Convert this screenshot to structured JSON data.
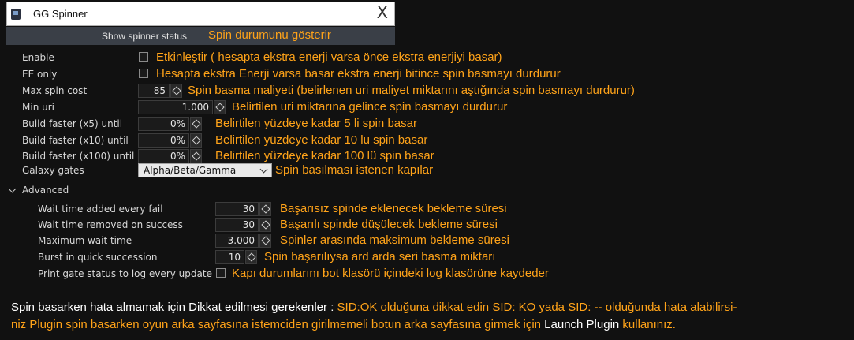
{
  "window": {
    "title": "GG Spinner",
    "close_glyph": "X"
  },
  "status": {
    "label": "Show spinner status",
    "note": "Spin durumunu gösterir"
  },
  "rows": {
    "enable": {
      "label": "Enable",
      "note": "Etkinleştir  ( hesapta ekstra enerji varsa önce  ekstra enerjiyi  basar)"
    },
    "ee_only": {
      "label": "EE only",
      "note": "Hesapta ekstra Enerji varsa basar ekstra enerji bitince spin basmayı  durdurur"
    },
    "max_spin_cost": {
      "label": "Max spin cost",
      "value": "85",
      "note": "Spin basma maliyeti (belirlenen uri maliyet miktarını aştığında spin basmayı durdurur)"
    },
    "min_uri": {
      "label": "Min uri",
      "value": "1.000",
      "note": "Belirtilen uri  miktarına gelince spin basmayı durdurur"
    },
    "build_x5": {
      "label": "Build faster (x5) until",
      "value": "0%",
      "note": "Belirtilen yüzdeye kadar 5 li  spin  basar"
    },
    "build_x10": {
      "label": "Build faster (x10) until",
      "value": "0%",
      "note": "Belirtilen yüzdeye kadar 10 lu spin  basar"
    },
    "build_x100": {
      "label": "Build faster (x100) until",
      "value": "0%",
      "note": "Belirtilen yüzdeye kadar 100 lü spin  basar"
    },
    "galaxy_gates": {
      "label": "Galaxy gates",
      "value": "Alpha/Beta/Gamma",
      "note": "Spin basılması istenen kapılar"
    }
  },
  "advanced": {
    "label": "Advanced",
    "wait_fail": {
      "label": "Wait time added every fail",
      "value": "30",
      "note": "Başarısız spinde eklenecek bekleme süresi"
    },
    "wait_success": {
      "label": "Wait time removed on success",
      "value": "30",
      "note": "Başarılı spinde düşülecek bekleme süresi"
    },
    "max_wait": {
      "label": "Maximum wait time",
      "value": "3.000",
      "note": "Spinler arasında maksimum bekleme süresi"
    },
    "burst": {
      "label": "Burst in quick succession",
      "value": "10",
      "note": "Spin başarılıysa ard arda seri basma miktarı"
    },
    "print_status": {
      "label": "Print gate status to log every update",
      "note": "Kapı durumlarını bot klasörü içindeki log klasörüne kaydeder"
    }
  },
  "footer": {
    "part1": "Spin basarken hata almamak için Dikkat edilmesi gerekenler : ",
    "part2": "SID:OK  olduğuna dikkat edin SID: KO yada SID: --  olduğunda  hata alabilirsi-",
    "part3": "niz Plugin spin  basarken oyun arka sayfasına istemciden  girilmemeli botun arka sayfasına  girmek  için  ",
    "part4": "Launch Plugin",
    "part5": "  kullanınız."
  },
  "colors": {
    "accent": "#ffa319",
    "background": "#111111",
    "label": "#d8d8d8"
  }
}
